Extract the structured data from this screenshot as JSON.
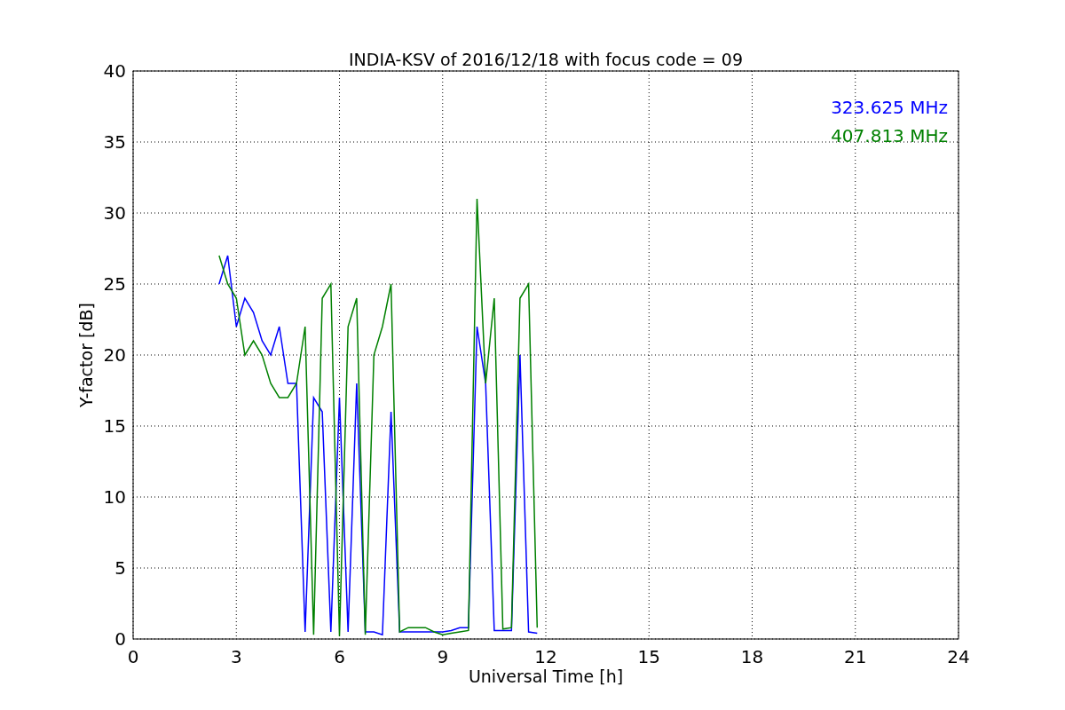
{
  "chart_data": {
    "type": "line",
    "title": "INDIA-KSV of 2016/12/18 with focus code = 09",
    "xlabel": "Universal Time [h]",
    "ylabel": "Y-factor [dB]",
    "x": [
      2.5,
      2.75,
      3.0,
      3.25,
      3.5,
      3.75,
      4.0,
      4.25,
      4.5,
      4.75,
      5.0,
      5.25,
      5.5,
      5.75,
      6.0,
      6.25,
      6.5,
      6.75,
      7.0,
      7.25,
      7.5,
      7.75,
      8.0,
      8.25,
      8.5,
      8.75,
      9.0,
      9.25,
      9.5,
      9.75,
      10.0,
      10.25,
      10.5,
      10.75,
      11.0,
      11.25,
      11.5,
      11.75
    ],
    "series": [
      {
        "name": "323.625 MHz",
        "color": "#0000ff",
        "values": [
          25,
          27,
          22,
          24,
          23,
          21,
          20,
          22,
          18,
          18,
          0.5,
          17,
          16,
          0.5,
          17,
          0.5,
          18,
          0.5,
          0.5,
          0.3,
          16,
          0.5,
          0.5,
          0.5,
          0.5,
          0.5,
          0.5,
          0.6,
          0.8,
          0.8,
          22,
          18,
          0.6,
          0.6,
          0.6,
          20,
          0.5,
          0.4
        ]
      },
      {
        "name": "407.813 MHz",
        "color": "#008000",
        "values": [
          27,
          25,
          24,
          20,
          21,
          20,
          18,
          17,
          17,
          18,
          22,
          0.3,
          24,
          25,
          0.2,
          22,
          24,
          0.3,
          20,
          22,
          25,
          0.5,
          0.8,
          0.8,
          0.8,
          0.5,
          0.3,
          0.4,
          0.5,
          0.6,
          31,
          18,
          24,
          0.7,
          0.8,
          24,
          25,
          0.8
        ]
      }
    ],
    "xlim": [
      0,
      24
    ],
    "ylim": [
      0,
      40
    ],
    "xticks": [
      0,
      3,
      6,
      9,
      12,
      15,
      18,
      21,
      24
    ],
    "yticks": [
      0,
      5,
      10,
      15,
      20,
      25,
      30,
      35,
      40
    ],
    "grid": true
  }
}
